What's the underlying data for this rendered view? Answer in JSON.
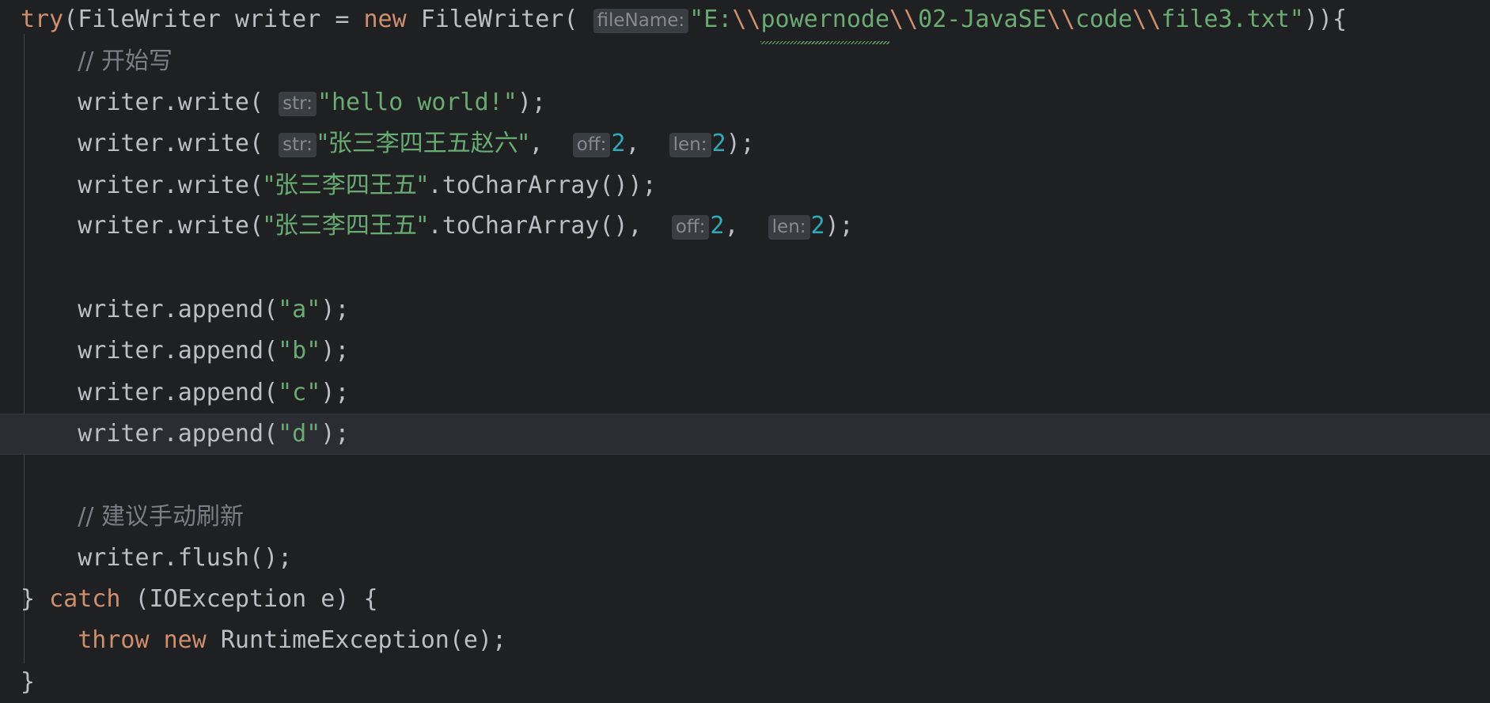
{
  "editor": {
    "background": "#1e2022",
    "caret_line_background": "#2b2d33",
    "indent_guide_color": "#414549",
    "colors": {
      "keyword": "#cf8e6d",
      "string": "#6aab73",
      "number": "#2aacb8",
      "comment": "#7a7e85",
      "default_text": "#bcbec4",
      "hint_background": "#3a3d41",
      "hint_text": "#868a91",
      "typo_squiggle": "#6aab73"
    },
    "language": "Java",
    "caret_line_index": 11
  },
  "code": {
    "full_text": "try(FileWriter writer = new FileWriter( fileName: \"E:\\\\powernode\\\\02-JavaSE\\\\code\\\\file3.txt\")){\n    // 开始写\n    writer.write( str: \"hello world!\");\n    writer.write( str: \"张三李四王五赵六\",  off: 2,  len: 2);\n    writer.write(\"张三李四王五\".toCharArray());\n    writer.write(\"张三李四王五\".toCharArray(),  off: 2,  len: 2);\n\n    writer.append(\"a\");\n    writer.append(\"b\");\n    writer.append(\"c\");\n    writer.append(\"d\");\n\n    // 建议手动刷新\n    writer.flush();\n} catch (IOException e) {\n    throw new RuntimeException(e);\n}",
    "tokens": {
      "kw_try": "try",
      "kw_new": "new",
      "kw_catch": "catch",
      "kw_throw": "throw",
      "type_filewriter": "FileWriter",
      "type_ioexception": "IOException",
      "type_runtimeexception": "RuntimeException",
      "var_writer": "writer",
      "var_e": "e",
      "method_write": "write",
      "method_append": "append",
      "method_flush": "flush",
      "method_tochararray": "toCharArray"
    },
    "hints": {
      "fileName": "fileName:",
      "str": "str:",
      "off": "off:",
      "len": "len:"
    },
    "strings": {
      "path_open_quote": "\"E:",
      "path_sep": "\\\\",
      "path_powernode": "powernode",
      "path_02javase": "02-JavaSE",
      "path_code": "code",
      "path_file3": "file3.txt\"",
      "hello_world": "\"hello world!\"",
      "cn_eight": "\"张三李四王五赵六\"",
      "cn_six": "\"张三李四王五\"",
      "letter_a": "\"a\"",
      "letter_b": "\"b\"",
      "letter_c": "\"c\"",
      "letter_d": "\"d\""
    },
    "numbers": {
      "off_value": "2",
      "len_value": "2"
    },
    "comments": {
      "start_writing": "// 开始写",
      "manual_flush": "// 建议手动刷新"
    },
    "punct": {
      "open_paren": "(",
      "close_paren": ")",
      "semicolon": ";",
      "comma": ",",
      "dot": ".",
      "open_brace": "{",
      "close_brace": "}",
      "equals": "=",
      "close_try_header": ")){",
      "close_call": ");",
      "close_double": "));",
      "catch_head": " catch (",
      "catch_tail": " e) {",
      "throw_tail": "(e);"
    }
  }
}
